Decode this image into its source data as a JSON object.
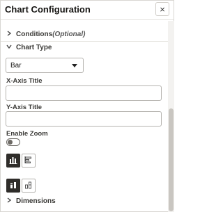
{
  "header": {
    "title": "Chart Configuration",
    "close_symbol": "×",
    "close_icon": "close-icon"
  },
  "sections": {
    "conditions": {
      "label": "Conditions",
      "optional_text": "(Optional)",
      "icon": "chevron-right-icon",
      "expanded": false
    },
    "chart_type": {
      "label": "Chart Type",
      "icon": "chevron-down-icon",
      "expanded": true
    },
    "dimensions": {
      "label": "Dimensions",
      "icon": "chevron-right-icon",
      "expanded": false
    }
  },
  "chart_type_select": {
    "selected": "Bar"
  },
  "x_axis": {
    "label": "X-Axis Title",
    "value": ""
  },
  "y_axis": {
    "label": "Y-Axis Title",
    "value": ""
  },
  "zoom": {
    "label": "Enable Zoom",
    "enabled": false
  },
  "orientation": {
    "options": [
      "vertical-bar-icon",
      "horizontal-bar-icon"
    ],
    "selected": "vertical-bar-icon"
  },
  "stacking": {
    "options": [
      "stacked-bar-icon",
      "grouped-bar-icon"
    ],
    "selected": "stacked-bar-icon"
  },
  "colors": {
    "selected_bg": "#2f2d2a",
    "border": "#b4b2ae",
    "text": "#161513"
  }
}
